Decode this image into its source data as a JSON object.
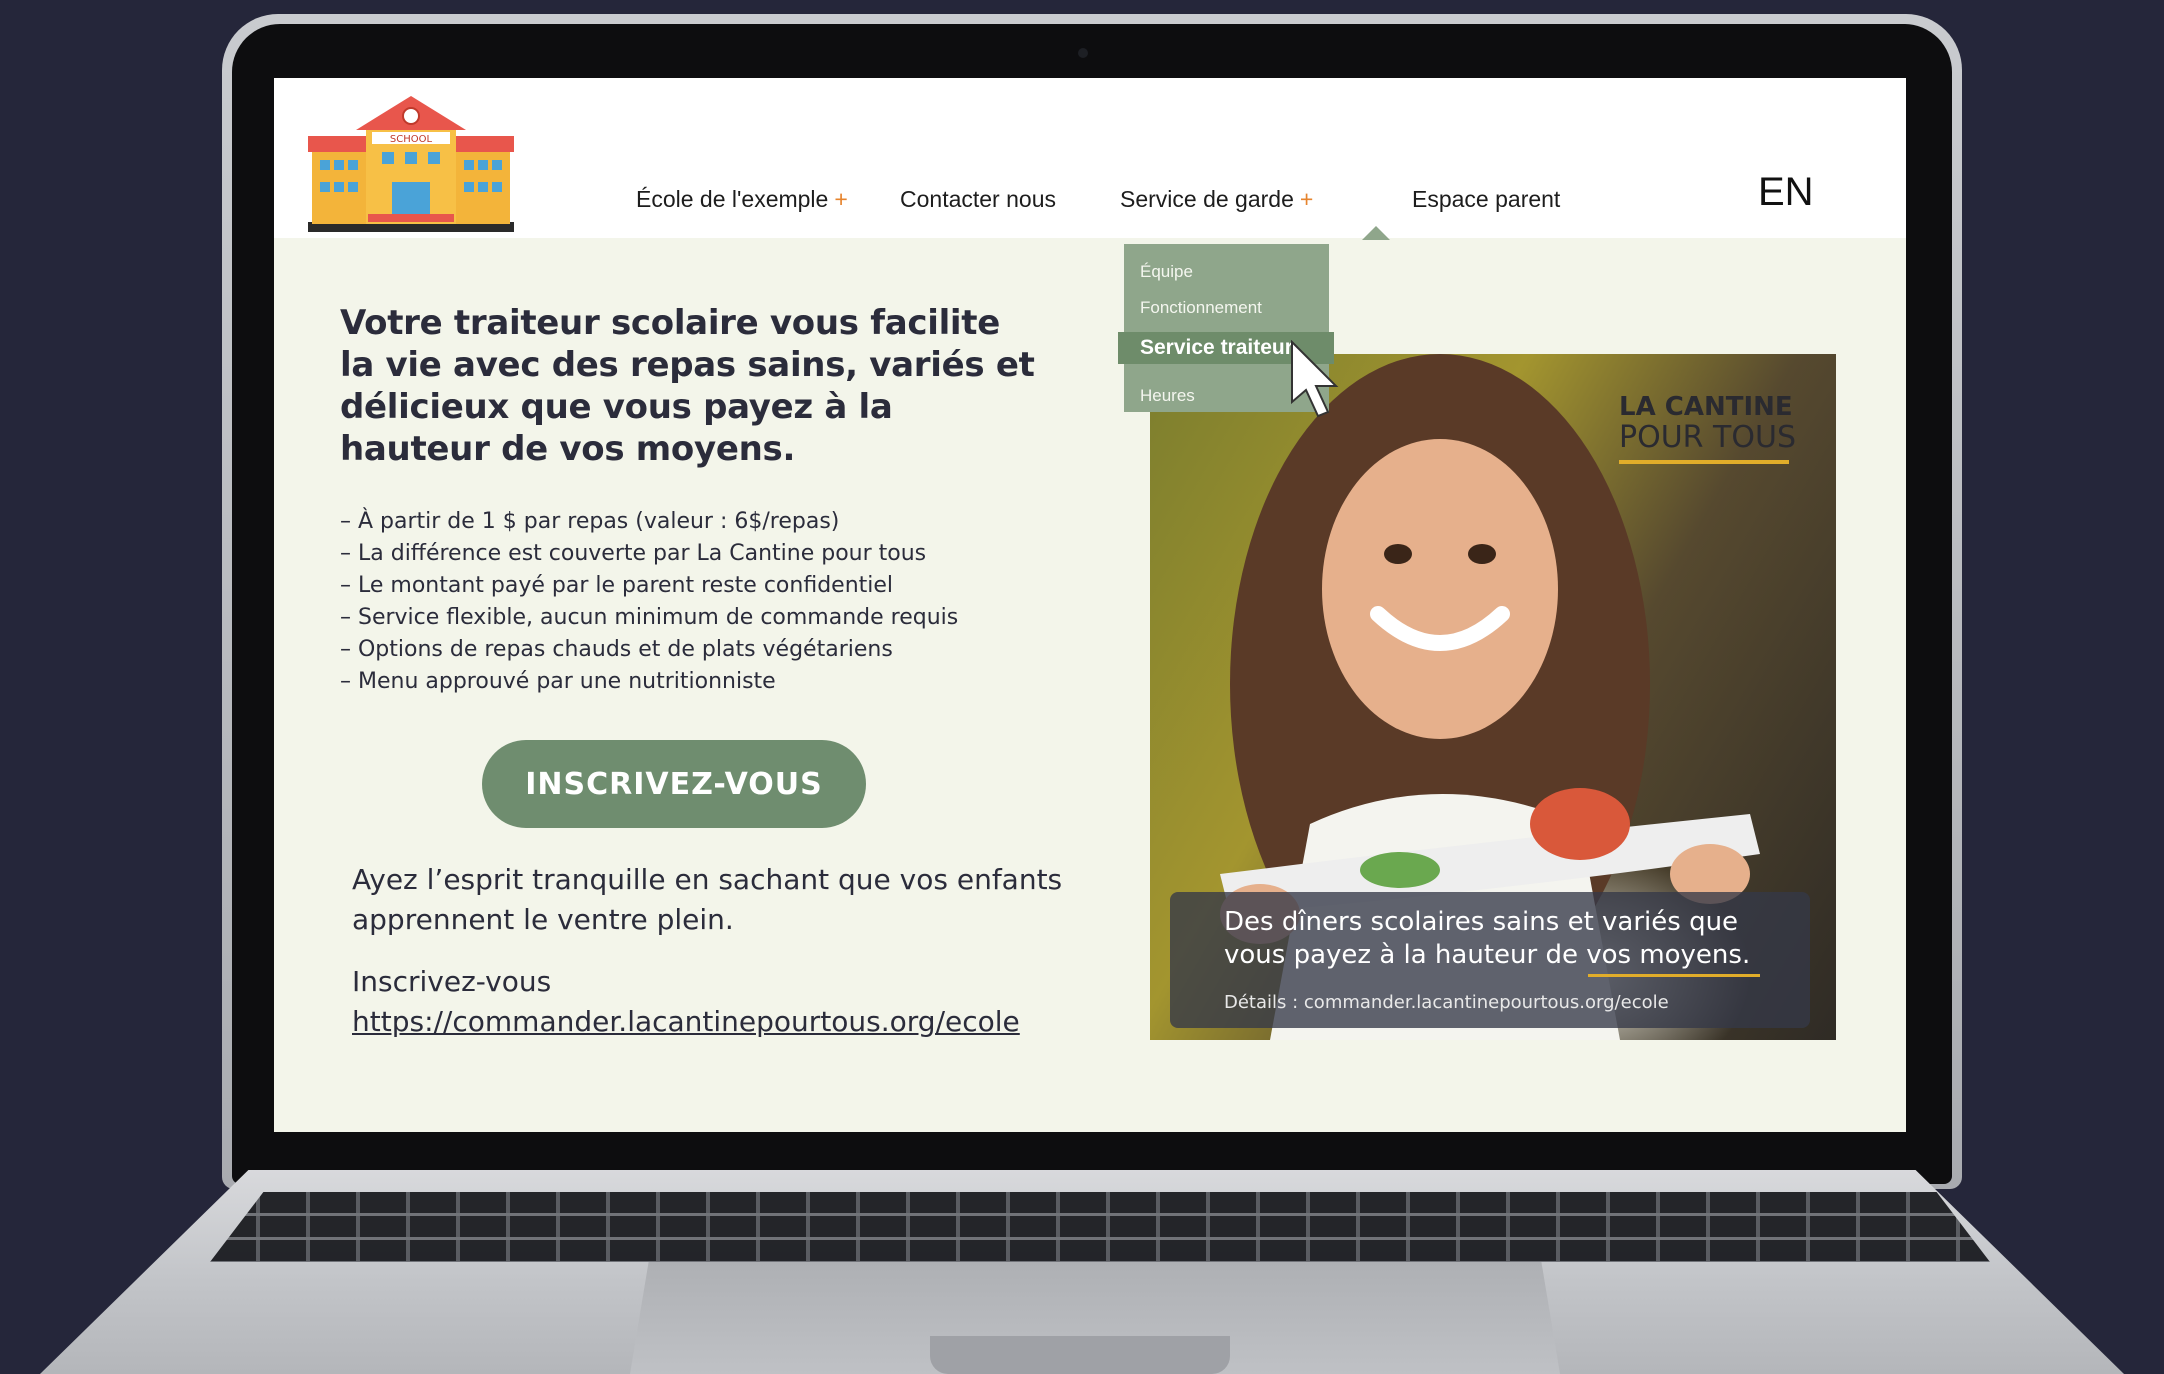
{
  "nav": {
    "items": [
      {
        "label": "École  de l'exemple",
        "has_submenu": true,
        "marker": "+"
      },
      {
        "label": "Contacter nous",
        "has_submenu": false
      },
      {
        "label": "Service de garde",
        "has_submenu": true,
        "marker": "+"
      },
      {
        "label": "Espace parent",
        "has_submenu": false
      }
    ],
    "language": "EN",
    "logo_text": "SCHOOL"
  },
  "dropdown": {
    "items": [
      "Équipe",
      "Fonctionnement",
      "Service traiteur",
      "Heures"
    ],
    "active": "Service traiteur"
  },
  "hero": {
    "headline": "Votre traiteur scolaire vous facilite la vie avec des repas sains, variés et délicieux que vous payez à la hauteur de vos moyens.",
    "bullets": [
      "– À partir de 1 $ par repas (valeur : 6$/repas)",
      "– La différence est couverte par La Cantine pour tous",
      "– Le montant payé par le parent reste confidentiel",
      "– Service flexible, aucun minimum de commande requis",
      "– Options de repas chauds et de plats végétariens",
      "– Menu approuvé par une nutritionniste"
    ],
    "cta_label": "INSCRIVEZ-VOUS",
    "tranquil": "Ayez l’esprit tranquille en sachant que vos enfants apprennent le ventre plein.",
    "signup_label": "Inscrivez-vous",
    "signup_link": "https://commander.lacantinepourtous.org/ecole "
  },
  "promo": {
    "brand_line1": "LA CANTINE",
    "brand_line2": "POUR TOUS",
    "caption": "Des dîners scolaires sains et variés que vous payez à la hauteur de vos moyens.",
    "details": "Détails : commander.lacantinepourtous.org/ecole"
  },
  "colors": {
    "page_bg": "#f3f5ea",
    "accent_green": "#6f8d6f",
    "dropdown_bg": "#8fa68b",
    "nav_plus": "#e6842e",
    "brand_yellow": "#e1ad2a"
  }
}
